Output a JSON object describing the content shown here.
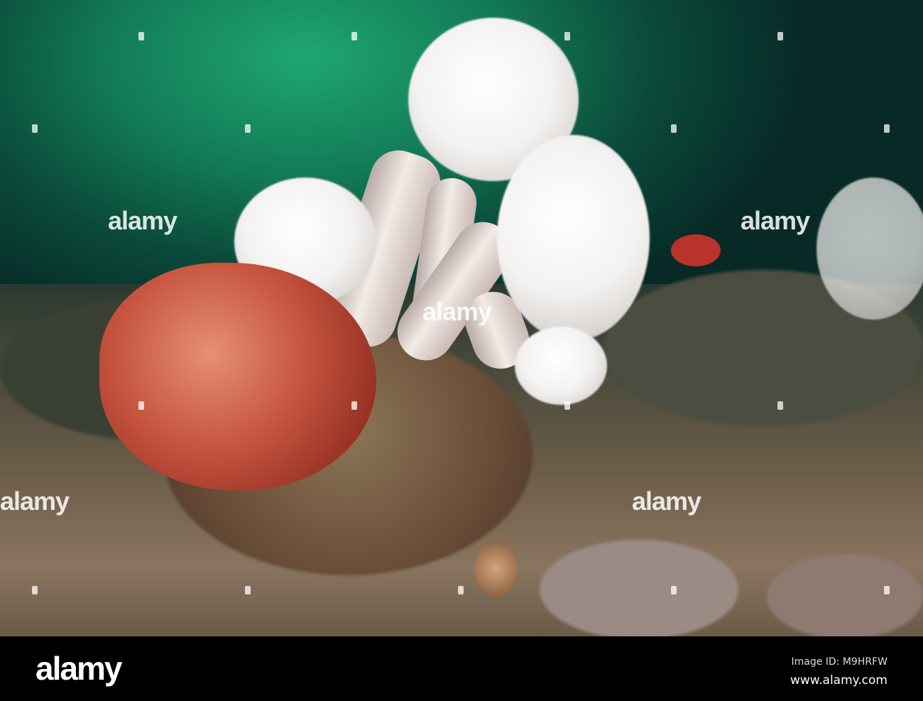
{
  "watermark": {
    "text": "alamy"
  },
  "footer": {
    "logo": "alamy",
    "image_id": "Image ID: M9HRFW",
    "url": "www.alamy.com"
  }
}
